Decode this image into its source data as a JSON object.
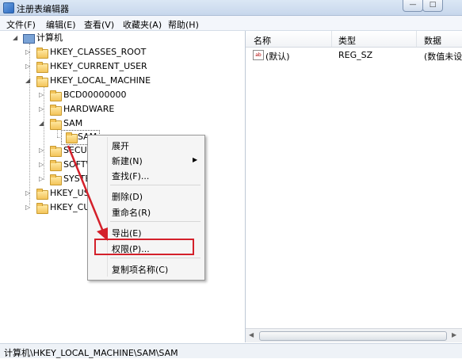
{
  "window": {
    "title": "注册表编辑器",
    "buttons": [
      "—",
      "□"
    ]
  },
  "menubar": [
    "文件(F)",
    "编辑(E)",
    "查看(V)",
    "收藏夹(A)",
    "帮助(H)"
  ],
  "tree": {
    "root": "计算机",
    "hives": [
      "HKEY_CLASSES_ROOT",
      "HKEY_CURRENT_USER",
      "HKEY_LOCAL_MACHINE",
      "HKEY_US",
      "HKEY_CU"
    ],
    "hklm_children": [
      "BCD00000000",
      "HARDWARE",
      "SAM",
      "SECUR",
      "SOFTW",
      "SYSTE"
    ],
    "sam_child": "SAM"
  },
  "columns": {
    "name": "名称",
    "type": "类型",
    "data": "数据"
  },
  "values": [
    {
      "icon": "ab",
      "name": "(默认)",
      "type": "REG_SZ",
      "data": "(数值未设置)"
    }
  ],
  "context_menu": {
    "expand": "展开",
    "new": "新建(N)",
    "find": "查找(F)...",
    "delete": "删除(D)",
    "rename": "重命名(R)",
    "export": "导出(E)",
    "permissions": "权限(P)...",
    "copy_key_name": "复制项名称(C)"
  },
  "statusbar": {
    "path": "计算机\\HKEY_LOCAL_MACHINE\\SAM\\SAM"
  },
  "colors": {
    "annotation_red": "#d4202a",
    "titlebar": "#dbe7f5"
  }
}
